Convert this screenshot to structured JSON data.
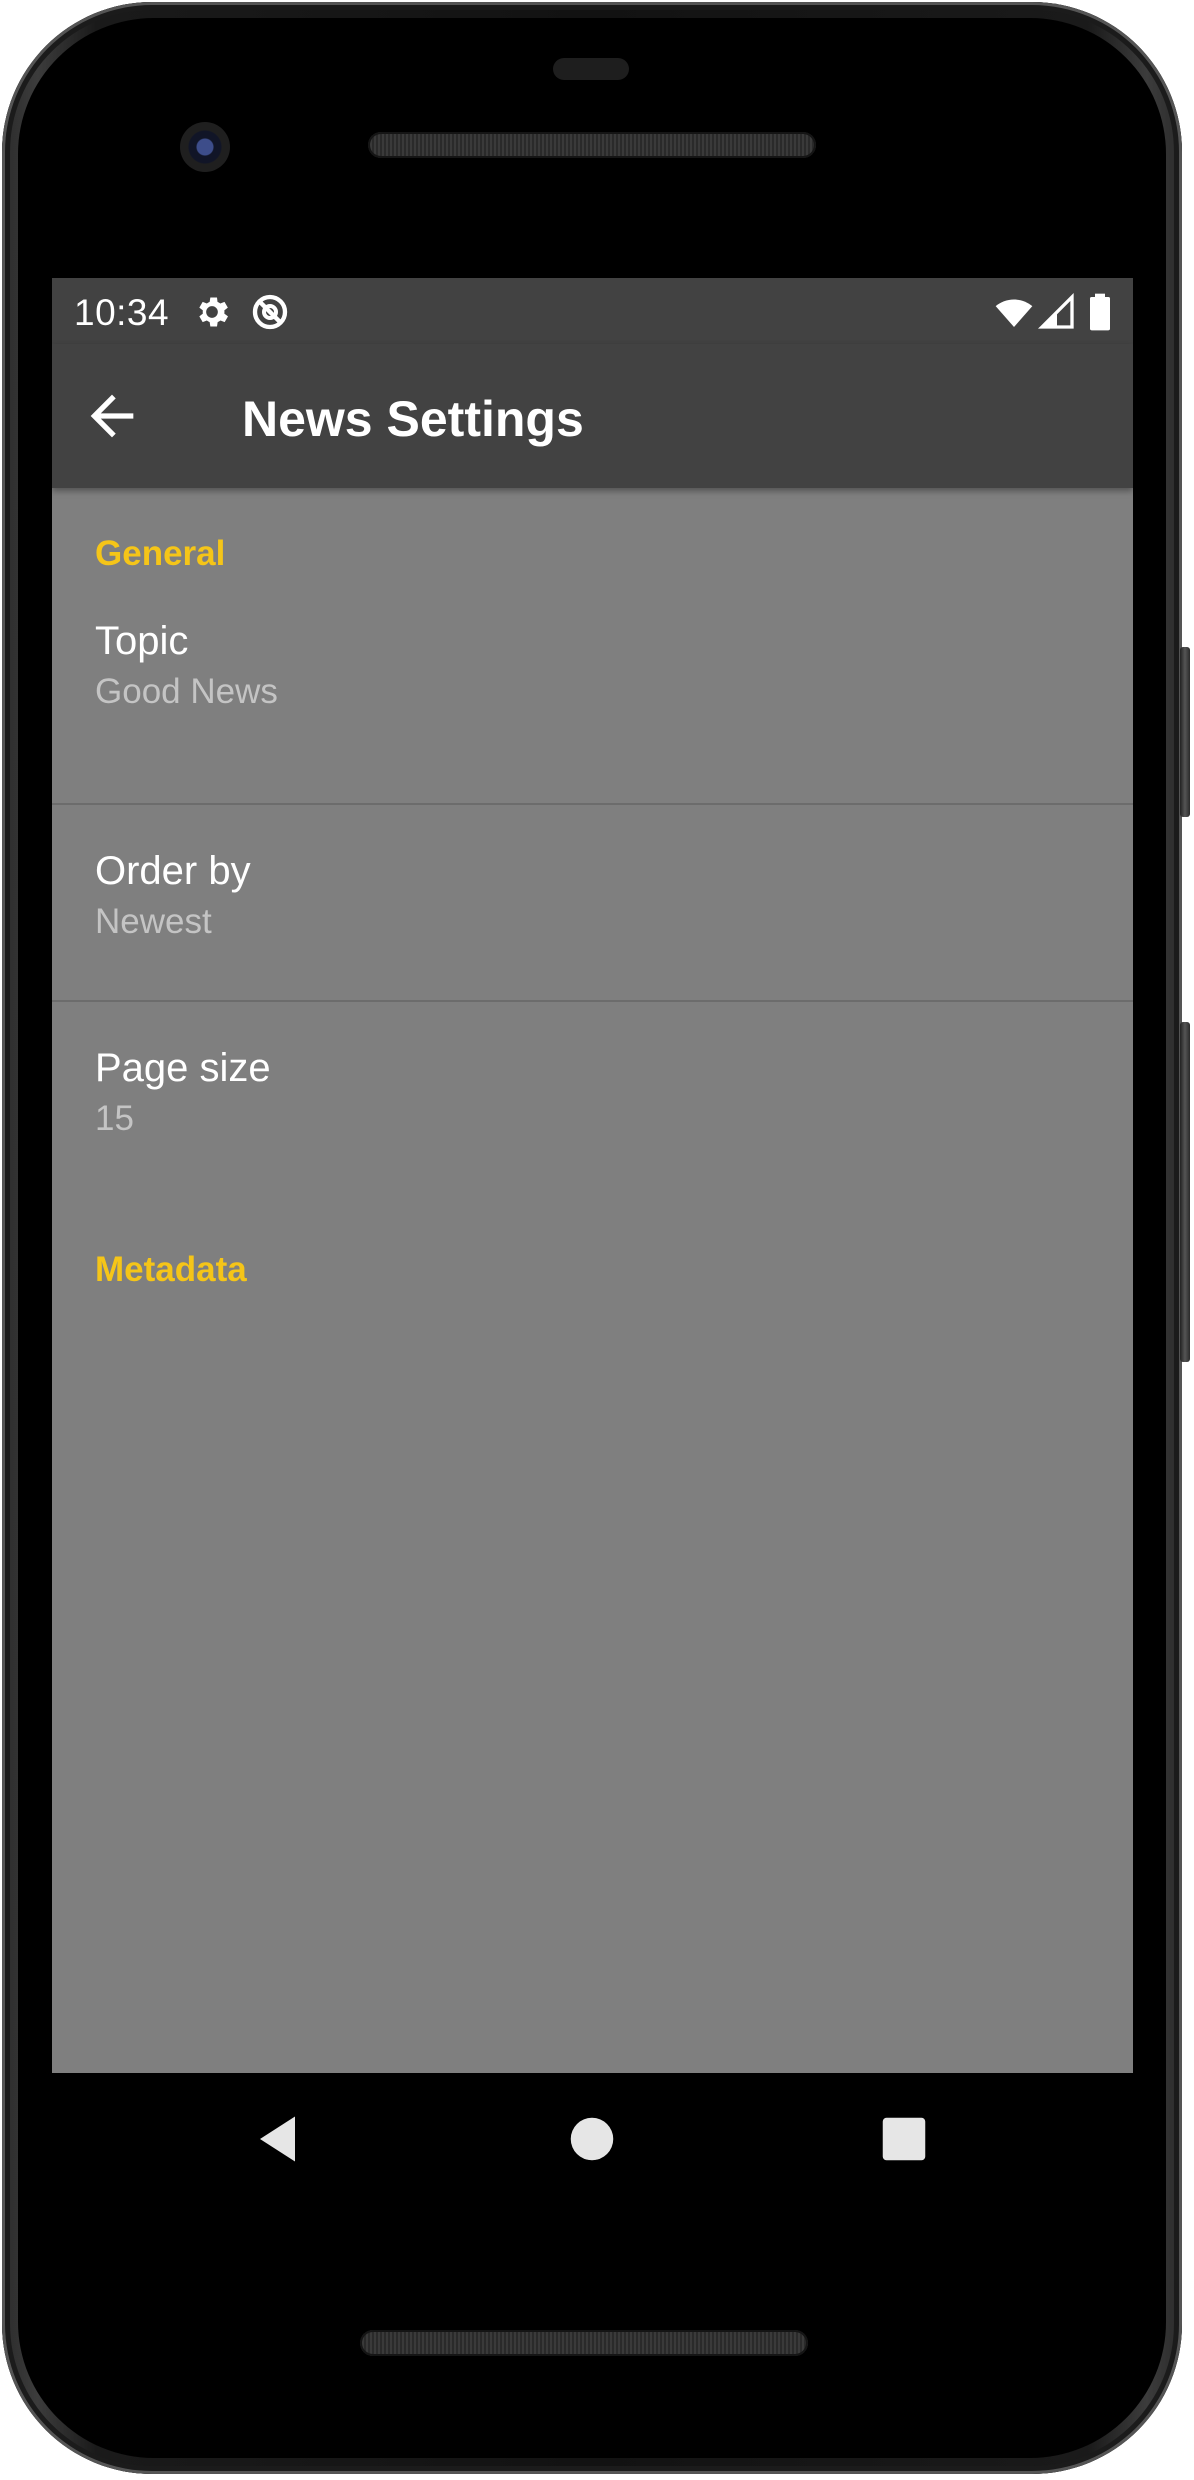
{
  "status_bar": {
    "time": "10:34",
    "left_icons": [
      "gear-icon",
      "no-sync-icon"
    ],
    "right_icons": [
      "wifi-icon",
      "signal-icon",
      "battery-icon"
    ]
  },
  "app_bar": {
    "back_icon": "arrow-left-icon",
    "title": "News Settings"
  },
  "settings": {
    "general_header": "General",
    "topic": {
      "title": "Topic",
      "summary": "Good News"
    },
    "order_by": {
      "title": "Order by",
      "summary": "Newest"
    },
    "page_size": {
      "title": "Page size",
      "summary": "15"
    },
    "metadata_header": "Metadata"
  },
  "nav_bar": {
    "icons": [
      "back-triangle-icon",
      "home-circle-icon",
      "recents-square-icon"
    ]
  },
  "colors": {
    "bar_bg": "#424242",
    "screen_bg": "#7f7f7f",
    "accent": "#f5c518",
    "text_primary": "#ffffff",
    "text_secondary": "#c4c4c4"
  }
}
